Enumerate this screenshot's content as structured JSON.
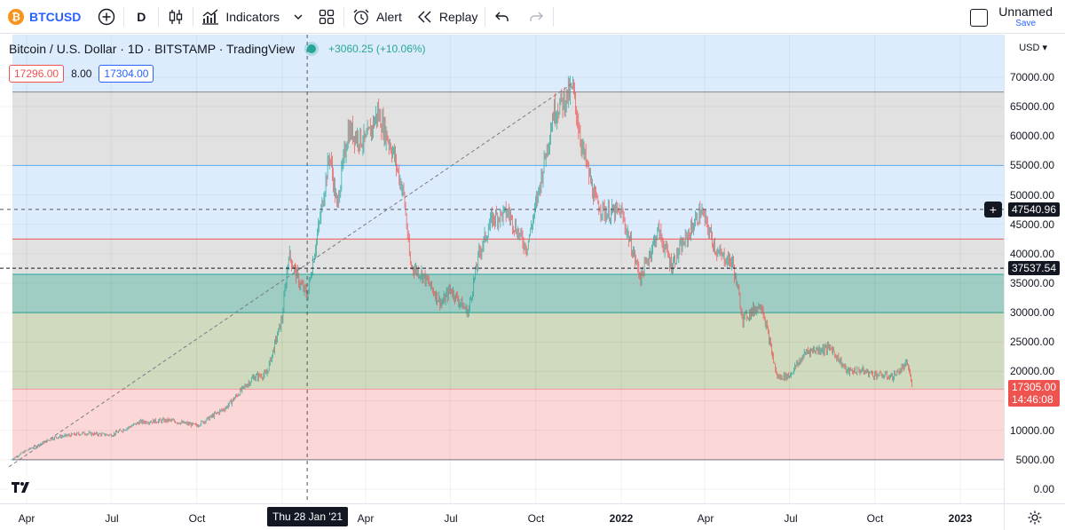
{
  "toolbar": {
    "symbol": "BTCUSD",
    "symbol_icon": "bitcoin-icon",
    "interval": "D",
    "indicators_label": "Indicators",
    "alert_label": "Alert",
    "replay_label": "Replay",
    "layout_name": "Unnamed",
    "save_label": "Save"
  },
  "legend": {
    "title": "Bitcoin / U.S. Dollar · 1D · BITSTAMP · TradingView",
    "change": "+3060.25 (+10.06%)",
    "sell": "17296.00",
    "spread": "8.00",
    "buy": "17304.00"
  },
  "price_scale": {
    "currency": "USD",
    "ticks": [
      "70000.00",
      "65000.00",
      "60000.00",
      "55000.00",
      "50000.00",
      "45000.00",
      "40000.00",
      "35000.00",
      "30000.00",
      "25000.00",
      "20000.00",
      "15000.00",
      "10000.00",
      "5000.00",
      "0.00"
    ],
    "crosshair_price": "47540.96",
    "level_price": "37537.54",
    "last_price": "17305.00",
    "countdown": "14:46:08"
  },
  "time_scale": {
    "labels": [
      {
        "text": "Apr",
        "bold": false
      },
      {
        "text": "Jul",
        "bold": false
      },
      {
        "text": "Oct",
        "bold": false
      },
      {
        "text": "Apr",
        "bold": false
      },
      {
        "text": "Jul",
        "bold": false
      },
      {
        "text": "Oct",
        "bold": false
      },
      {
        "text": "2022",
        "bold": true
      },
      {
        "text": "Apr",
        "bold": false
      },
      {
        "text": "Jul",
        "bold": false
      },
      {
        "text": "Oct",
        "bold": false
      },
      {
        "text": "2023",
        "bold": true
      }
    ],
    "crosshair_date": "Thu 28 Jan '21"
  },
  "colors": {
    "up": "#26a69a",
    "down": "#ef5350",
    "accent": "#2962ff",
    "band_top_blue": "#d6e9fb",
    "band_gray": "#dcdcdc",
    "band_teal": "#8fc4b8",
    "band_olive": "#c8d3b3",
    "band_pink": "#fbd0d0"
  },
  "chart_data": {
    "type": "candlestick",
    "symbol": "BTCUSD",
    "interval": "1D",
    "x_range": [
      "2020-02",
      "2023-02"
    ],
    "ylim": [
      0,
      75000
    ],
    "series": [
      {
        "name": "close",
        "x": [
          "2020-03-15",
          "2020-04-01",
          "2020-05-01",
          "2020-06-01",
          "2020-07-01",
          "2020-08-01",
          "2020-09-01",
          "2020-10-01",
          "2020-11-01",
          "2020-12-01",
          "2020-12-15",
          "2021-01-01",
          "2021-01-08",
          "2021-01-20",
          "2021-01-28",
          "2021-02-10",
          "2021-02-21",
          "2021-03-01",
          "2021-03-13",
          "2021-04-01",
          "2021-04-14",
          "2021-05-01",
          "2021-05-12",
          "2021-05-19",
          "2021-06-01",
          "2021-06-22",
          "2021-07-01",
          "2021-07-20",
          "2021-08-01",
          "2021-08-15",
          "2021-09-01",
          "2021-09-21",
          "2021-10-01",
          "2021-10-20",
          "2021-11-10",
          "2021-11-20",
          "2021-12-04",
          "2021-12-15",
          "2022-01-01",
          "2022-01-22",
          "2022-02-10",
          "2022-02-24",
          "2022-03-28",
          "2022-04-15",
          "2022-05-01",
          "2022-05-12",
          "2022-06-01",
          "2022-06-13",
          "2022-06-18",
          "2022-07-01",
          "2022-07-20",
          "2022-08-15",
          "2022-09-01",
          "2022-09-15",
          "2022-10-01",
          "2022-10-20",
          "2022-11-05",
          "2022-11-09",
          "2022-11-10"
        ],
        "values": [
          5000,
          6600,
          8800,
          9500,
          9200,
          11400,
          11700,
          10800,
          13800,
          19000,
          19500,
          29000,
          40000,
          35000,
          33000,
          45000,
          57000,
          48000,
          61000,
          59000,
          64000,
          57000,
          50000,
          38000,
          36500,
          31500,
          34000,
          30000,
          40000,
          46000,
          47000,
          41000,
          48000,
          64000,
          68000,
          58000,
          49000,
          47000,
          47000,
          36000,
          44000,
          38000,
          47300,
          40000,
          38500,
          29000,
          31500,
          22500,
          19000,
          19300,
          23500,
          24000,
          20000,
          20200,
          19500,
          19100,
          21300,
          18500,
          17305
        ]
      },
      {
        "name": "horizontal levels",
        "values": [
          67500,
          55000,
          42500,
          36500,
          30000,
          17000,
          5000
        ]
      }
    ],
    "fib_levels": [
      5000,
      17000,
      30000,
      36500,
      42500,
      55000,
      67500
    ],
    "trend_line": {
      "from": [
        "2020-03-13",
        3800
      ],
      "to": [
        "2021-11-10",
        69000
      ]
    },
    "crosshair": {
      "date": "2021-01-28",
      "price": 47540.96
    },
    "dashed_level": 37537.54,
    "last_price": 17305.0
  }
}
